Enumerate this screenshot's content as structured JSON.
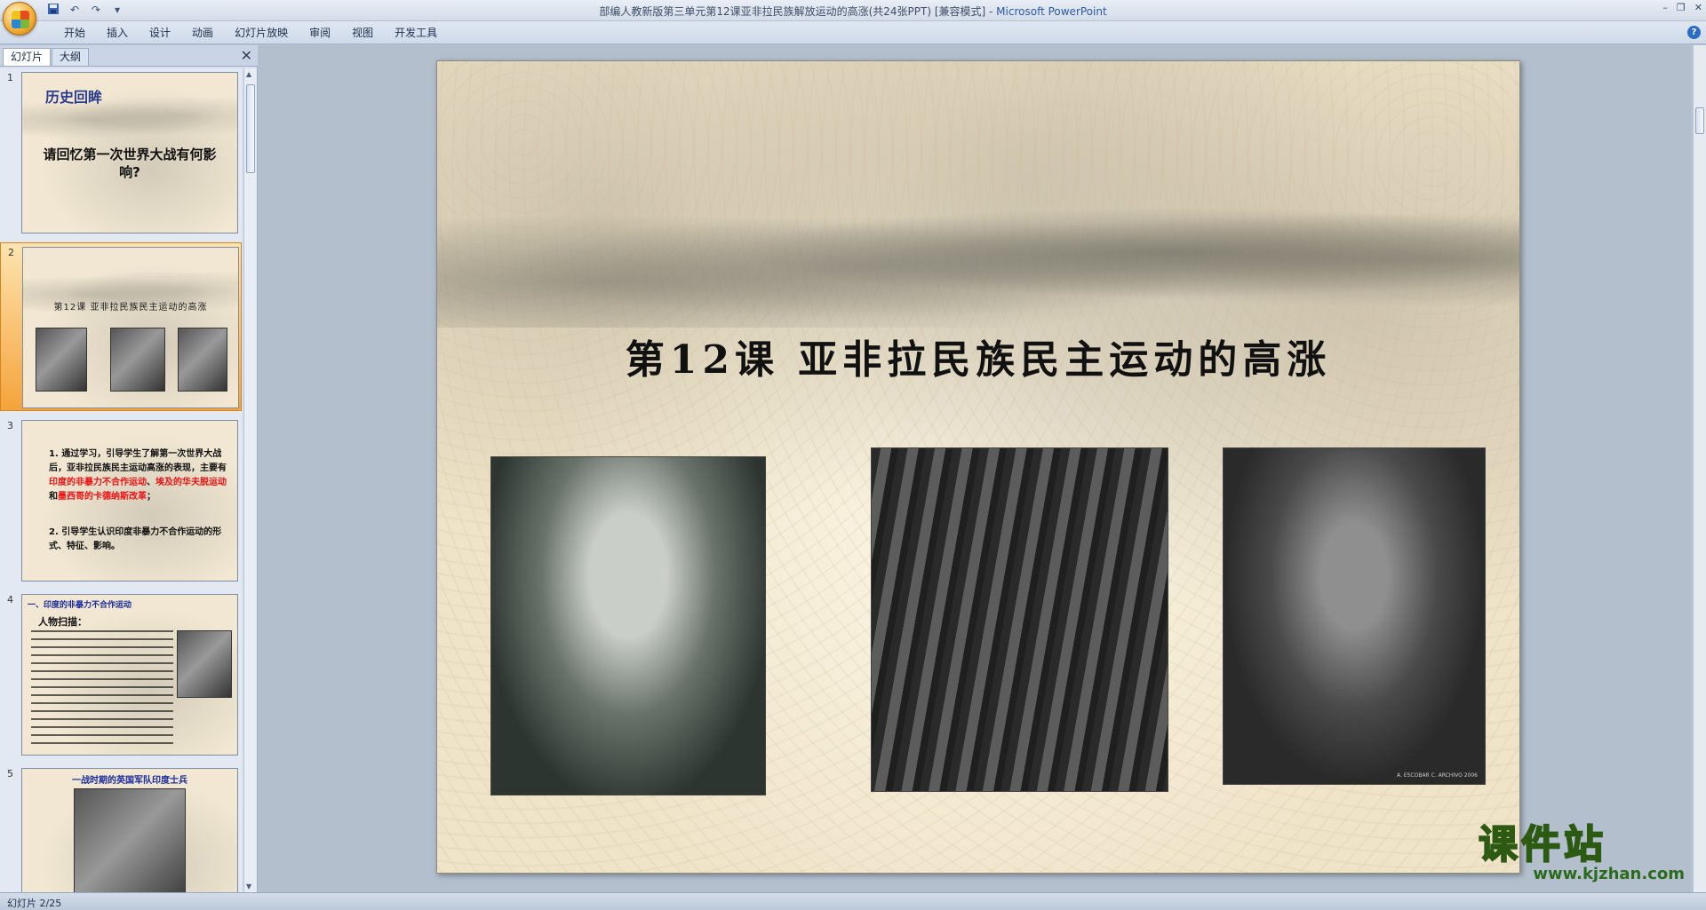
{
  "window": {
    "title": "部编人教新版第三单元第12课亚非拉民族解放运动的高涨(共24张PPT) [兼容模式]",
    "separator": " - ",
    "app_name": "Microsoft PowerPoint"
  },
  "quick_access": {
    "undo_glyph": "↶",
    "redo_glyph": "↷",
    "more_glyph": "▾"
  },
  "window_controls": {
    "minimize": "–",
    "restore": "❐",
    "close": "✕"
  },
  "ribbon": {
    "tabs": [
      "开始",
      "插入",
      "设计",
      "动画",
      "幻灯片放映",
      "审阅",
      "视图",
      "开发工具"
    ],
    "help": "?"
  },
  "left_panel": {
    "tab_slides": "幻灯片",
    "tab_outline": "大纲",
    "close": "✕"
  },
  "thumbnails": [
    {
      "num": "1",
      "title": "历史回眸",
      "question": "请回忆第一次世界大战有何影响?"
    },
    {
      "num": "2",
      "title": "第12课  亚非拉民族民主运动的高涨"
    },
    {
      "num": "3",
      "line1_a": "1. 通过学习，引导学生了解第一次世界大战后，亚非拉民族民主运动高涨的表现，主要有",
      "line1_red1": "印度的非暴力不合作运动",
      "line1_b": "、",
      "line1_red2": "埃及的华夫脱运动",
      "line1_c": "和",
      "line1_red3": "墨西哥的卡德纳斯改革",
      "line1_d": "；",
      "line2": "2. 引导学生认识印度非暴力不合作运动的形式、特征、影响。"
    },
    {
      "num": "4",
      "head": "一、印度的非暴力不合作运动",
      "sub": "人物扫描："
    },
    {
      "num": "5",
      "title": "一战时期的英国军队印度士兵"
    }
  ],
  "slide": {
    "title": "第12课  亚非拉民族民主运动的高涨",
    "photo3_credit": "A. ESCOBAR C. ARCHIVO 2006"
  },
  "watermark": {
    "cn": "课件站",
    "url": "www.kjzhan.com"
  },
  "status": {
    "slide_position": "幻灯片 2/25"
  }
}
